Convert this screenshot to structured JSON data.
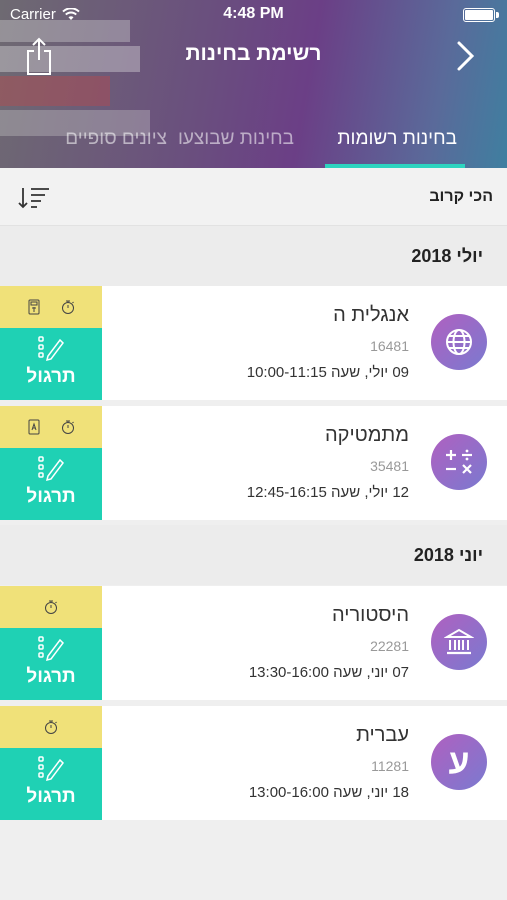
{
  "status": {
    "carrier": "Carrier",
    "time": "4:48 PM"
  },
  "header": {
    "title": "רשימת בחינות",
    "tabs": [
      {
        "label": "בחינות רשומות",
        "active": true
      },
      {
        "label": "בחינות שבוצעו",
        "active": false
      },
      {
        "label": "ציונים סופיים",
        "active": false
      }
    ]
  },
  "sort": {
    "label": "הכי קרוב"
  },
  "groups": [
    {
      "month": "יולי 2018",
      "exams": [
        {
          "name": "אנגלית ה",
          "code": "16481",
          "when": "09 יולי, שעה 10:00-11:15",
          "icon": "globe-icon",
          "practice": "תרגול"
        },
        {
          "name": "מתמטיקה",
          "code": "35481",
          "when": "12 יולי, שעה 12:45-16:15",
          "icon": "math-operators-icon",
          "practice": "תרגול"
        }
      ]
    },
    {
      "month": "יוני 2018",
      "exams": [
        {
          "name": "היסטוריה",
          "code": "22281",
          "when": "07 יוני, שעה 13:30-16:00",
          "icon": "building-columns-icon",
          "practice": "תרגול"
        },
        {
          "name": "עברית",
          "code": "11281",
          "when": "18 יוני, שעה 13:00-16:00",
          "icon": "hebrew-letter-ayin-icon",
          "letter": "ע",
          "practice": "תרגול"
        }
      ]
    }
  ],
  "colors": {
    "accent": "#1fd1b4",
    "tools": "#f0e179",
    "icon_gradient_start": "#b060c0",
    "icon_gradient_end": "#7a7ad0"
  }
}
